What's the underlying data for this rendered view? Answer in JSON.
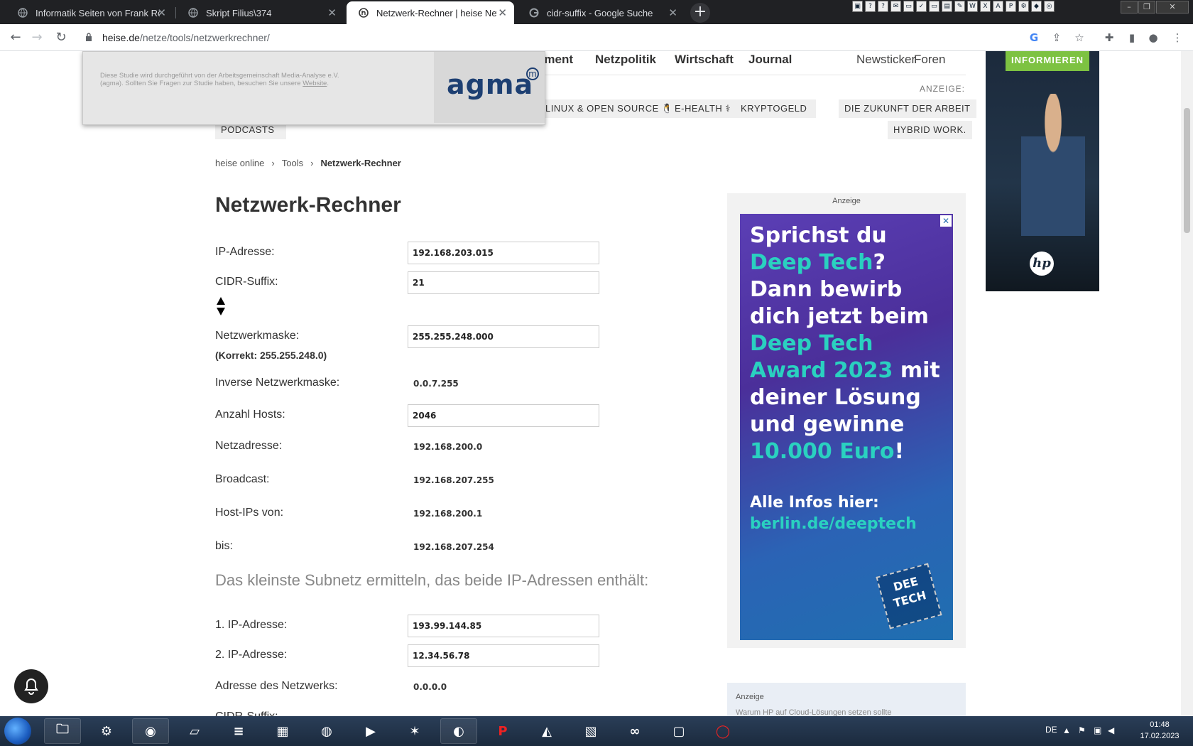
{
  "browser": {
    "tabs": [
      {
        "title": "Informatik Seiten von Frank Rost",
        "icon": "globe-icon",
        "active": false
      },
      {
        "title": "Skript Filius\\374",
        "icon": "globe-icon",
        "active": false
      },
      {
        "title": "Netzwerk-Rechner | heise Netze",
        "icon": "heise-icon",
        "active": true
      },
      {
        "title": "cidr-suffix - Google Suche",
        "icon": "google-icon",
        "active": false
      }
    ],
    "new_tab": "+",
    "url_host": "heise.de",
    "url_path": "/netze/tools/netzwerkrechner/"
  },
  "site": {
    "nav": {
      "truncated": "nment",
      "links": [
        "Netzpolitik",
        "Wirtschaft",
        "Journal"
      ],
      "right": [
        "Newsticker",
        "Foren"
      ]
    },
    "anzeige": "ANZEIGE:",
    "pills_row1": [
      "LINUX & OPEN SOURCE 🐧",
      "E-HEALTH ⚕",
      "KRYPTOGELD"
    ],
    "pills_right": [
      "DIE ZUKUNFT DER ARBEIT",
      "HYBRID WORK."
    ],
    "pill_podcasts": "PODCASTS",
    "breadcrumb": [
      "heise online",
      "Tools",
      "Netzwerk-Rechner"
    ],
    "breadcrumb_sep": "›",
    "title": "Netzwerk-Rechner"
  },
  "calculator": {
    "ip_label": "IP-Adresse:",
    "ip_value": "192.168.203.015",
    "cidr_label": "CIDR-Suffix:",
    "cidr_value": "21",
    "mask_label": "Netzwerkmaske:",
    "mask_value": "255.255.248.000",
    "mask_correct": "(Korrekt: 255.255.248.0)",
    "inverse_label": "Inverse Netzwerkmaske:",
    "inverse_value": "0.0.7.255",
    "hosts_label": "Anzahl Hosts:",
    "hosts_value": "2046",
    "net_label": "Netzadresse:",
    "net_value": "192.168.200.0",
    "bcast_label": "Broadcast:",
    "bcast_value": "192.168.207.255",
    "from_label": "Host-IPs von:",
    "from_value": "192.168.200.1",
    "to_label": "bis:",
    "to_value": "192.168.207.254",
    "subnet_heading": "Das kleinste Subnetz ermitteln, das beide IP-Adressen enthält:",
    "ip1_label": "1. IP-Adresse:",
    "ip1_value": "193.99.144.85",
    "ip2_label": "2. IP-Adresse:",
    "ip2_value": "12.34.56.78",
    "netaddr_label": "Adresse des Netzwerks:",
    "netaddr_value": "0.0.0.0",
    "cidr2_label": "CIDR-Suffix:"
  },
  "popup": {
    "note_line1": "Diese Studie wird durchgeführt von der Arbeitsgemeinschaft Media-Analyse e.V.",
    "note_line2": "(agma). Sollten Sie Fragen zur Studie haben, besuchen Sie unsere",
    "note_link": "Website",
    "logo": "agma",
    "logo_mark": "m"
  },
  "ads": {
    "label": "Anzeige",
    "main_l1": "Sprichst du",
    "main_l2": "Deep Tech",
    "main_l2b": "?",
    "main_l3": "Dann bewirb",
    "main_l4": "dich jetzt beim",
    "main_l5": "Deep Tech",
    "main_l6": "Award 2023",
    "main_l6b": " mit",
    "main_l7": "deiner Lösung",
    "main_l8": "und gewinne",
    "main_l9": "10.000 Euro",
    "main_l9b": "!",
    "info_l1": "Alle Infos hier:",
    "info_l2": "berlin.de/deeptech",
    "chip_text": "DEE TECH",
    "close": "✕",
    "side_cta": "INFORMIEREN",
    "side_brand": "hp",
    "ad2_label": "Anzeige",
    "ad2_text": "Warum HP auf Cloud-Lösungen setzen sollte"
  },
  "taskbar": {
    "lang": "DE",
    "time": "01:48",
    "date": "17.02.2023"
  },
  "colors": {
    "ad_teal": "#2ad1c0",
    "cta_green": "#7dc242",
    "agma_blue": "#1d3f72"
  }
}
